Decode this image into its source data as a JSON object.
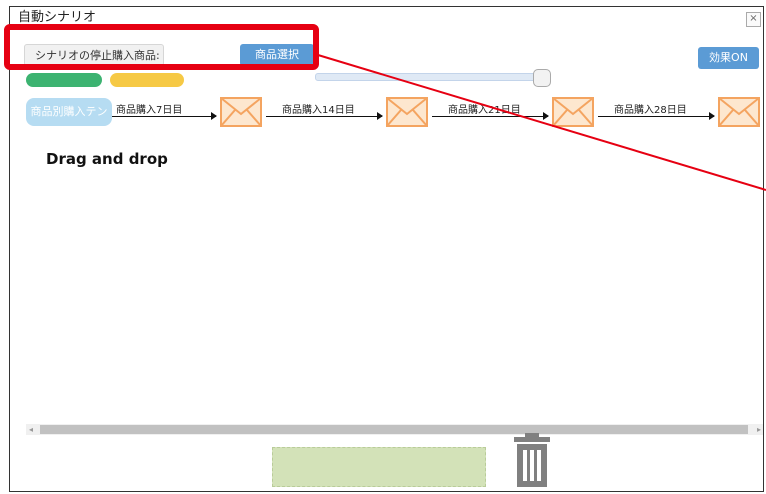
{
  "dialog": {
    "title": "自動シナリオ",
    "close_label": "×"
  },
  "toolbar": {
    "condition_label": "シナリオの停止購入商品:",
    "select_button": "商品選択",
    "effect_button": "効果ON"
  },
  "scenario": {
    "first_step": "商品別購入テン",
    "connectors": [
      {
        "label": "商品購入7日目",
        "icon": "mail-icon"
      },
      {
        "label": "商品購入14日目",
        "icon": "mail-icon"
      },
      {
        "label": "商品購入21日目",
        "icon": "mail-icon"
      },
      {
        "label": "商品購入28日目",
        "icon": "mail-icon"
      }
    ]
  },
  "hint": {
    "drag_drop": "Drag and drop"
  },
  "footer": {
    "trash_icon": "trash-icon"
  },
  "colors": {
    "primary_button": "#5b9bd5",
    "highlight": "#e60012",
    "mail_stroke": "#f4a460",
    "mail_fill": "#fde7cf",
    "drop_zone": "#d3e2b8"
  }
}
